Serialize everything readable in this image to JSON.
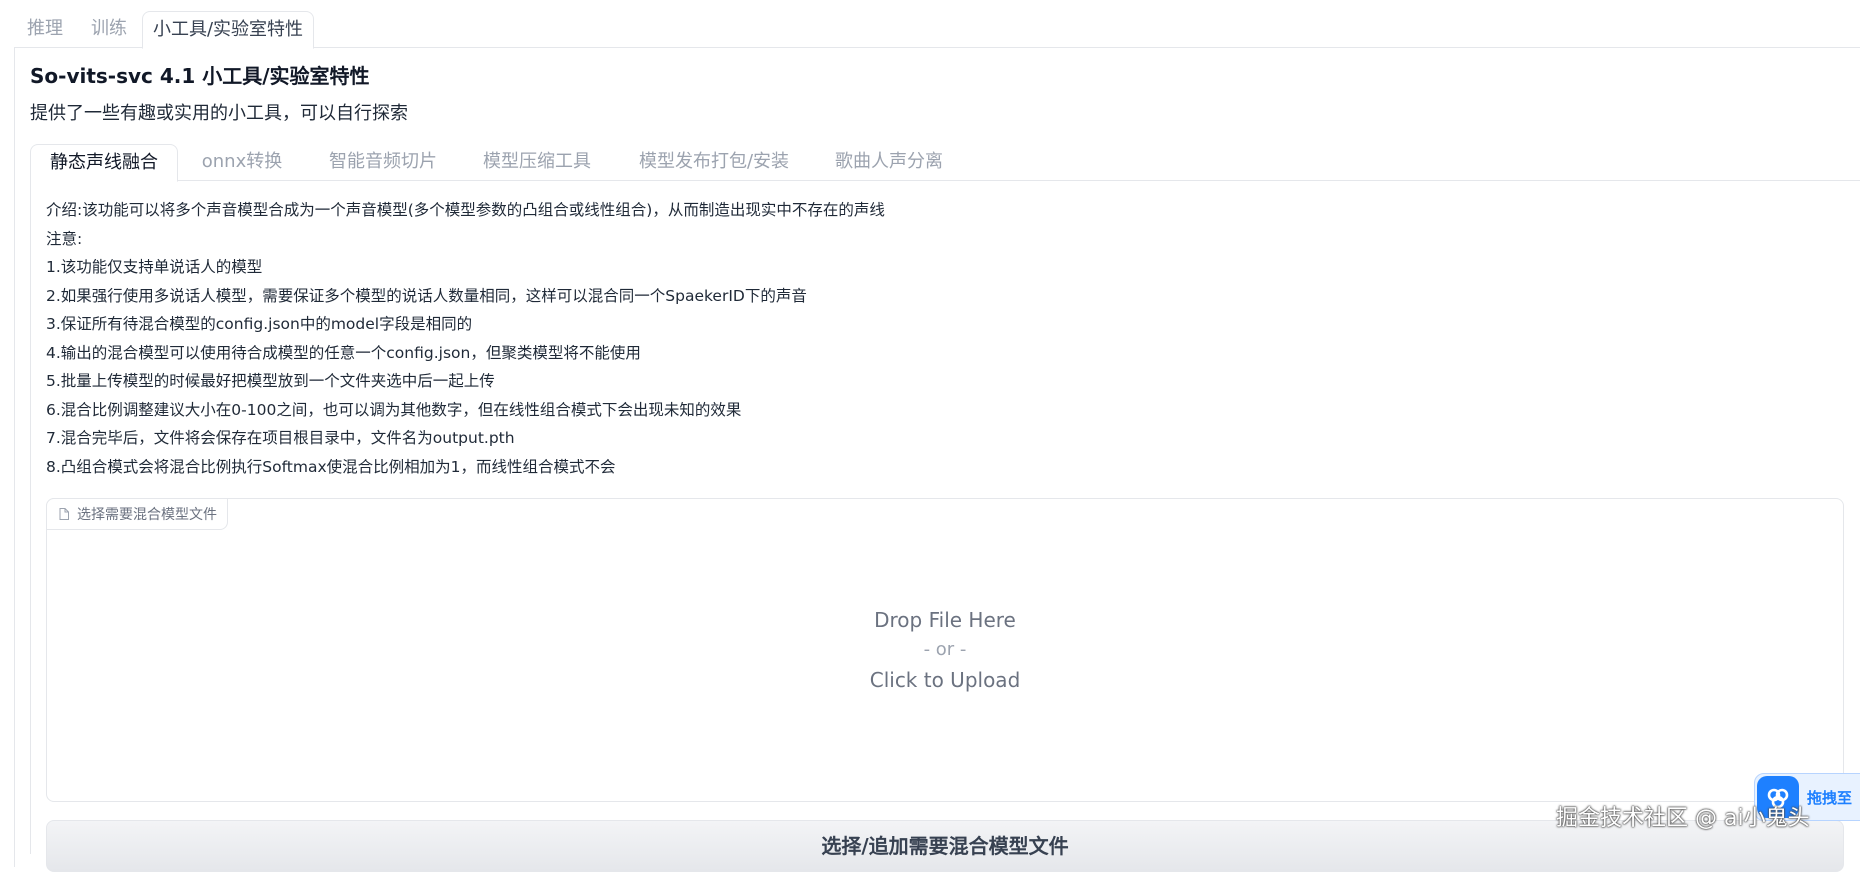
{
  "top_tabs": [
    {
      "label": "推理"
    },
    {
      "label": "训练"
    },
    {
      "label": "小工具/实验室特性",
      "active": true
    }
  ],
  "header": {
    "title": "So-vits-svc 4.1 小工具/实验室特性",
    "subtitle": "提供了一些有趣或实用的小工具，可以自行探索"
  },
  "inner_tabs": [
    {
      "label": "静态声线融合",
      "active": true
    },
    {
      "label": "onnx转换"
    },
    {
      "label": "智能音频切片"
    },
    {
      "label": "模型压缩工具"
    },
    {
      "label": "模型发布打包/安装"
    },
    {
      "label": "歌曲人声分离"
    }
  ],
  "intro": [
    "介绍:该功能可以将多个声音模型合成为一个声音模型(多个模型参数的凸组合或线性组合)，从而制造出现实中不存在的声线",
    "注意:",
    "1.该功能仅支持单说话人的模型",
    "2.如果强行使用多说话人模型，需要保证多个模型的说话人数量相同，这样可以混合同一个SpaekerID下的声音",
    "3.保证所有待混合模型的config.json中的model字段是相同的",
    "4.输出的混合模型可以使用待合成模型的任意一个config.json，但聚类模型将不能使用",
    "5.批量上传模型的时候最好把模型放到一个文件夹选中后一起上传",
    "6.混合比例调整建议大小在0-100之间，也可以调为其他数字，但在线性组合模式下会出现未知的效果",
    "7.混合完毕后，文件将会保存在项目根目录中，文件名为output.pth",
    "8.凸组合模式会将混合比例执行Softmax使混合比例相加为1，而线性组合模式不会"
  ],
  "upload": {
    "label": "选择需要混合模型文件",
    "drop": "Drop File Here",
    "or": "- or -",
    "click": "Click to Upload",
    "icon": "file-icon"
  },
  "button": {
    "label": "选择/追加需要混合模型文件"
  },
  "widget": {
    "text": "拖拽至",
    "icon": "juejin-logo-icon"
  },
  "watermark": "掘金技术社区 @ ai小鬼头",
  "colors": {
    "accent": "#1e80ff",
    "border": "#e5e7eb",
    "muted_text": "#9ca3af"
  }
}
